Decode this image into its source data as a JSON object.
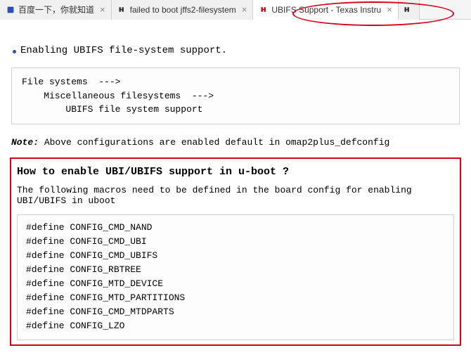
{
  "tabs": [
    {
      "title": "百度一下，你就知道",
      "icon": "baidu"
    },
    {
      "title": "failed to boot jffs2-filesystem",
      "icon": "ti"
    },
    {
      "title": "UBIFS Support - Texas Instru",
      "icon": "ti-red"
    },
    {
      "title": "",
      "icon": "ti"
    }
  ],
  "content": {
    "bullet": "Enabling UBIFS file-system support.",
    "code1": "File systems  --->\n    Miscellaneous filesystems  --->\n        UBIFS file system support",
    "note_label": "Note:",
    "note_text": " Above configurations are enabled default in omap2plus_defconfig",
    "heading": "How to enable UBI/UBIFS support in u-boot ?",
    "para": "The following macros need to be defined in the board config for enabling UBI/UBIFS in uboot",
    "defines": "#define CONFIG_CMD_NAND\n#define CONFIG_CMD_UBI\n#define CONFIG_CMD_UBIFS\n#define CONFIG_RBTREE\n#define CONFIG_MTD_DEVICE\n#define CONFIG_MTD_PARTITIONS\n#define CONFIG_CMD_MTDPARTS\n#define CONFIG_LZO"
  }
}
